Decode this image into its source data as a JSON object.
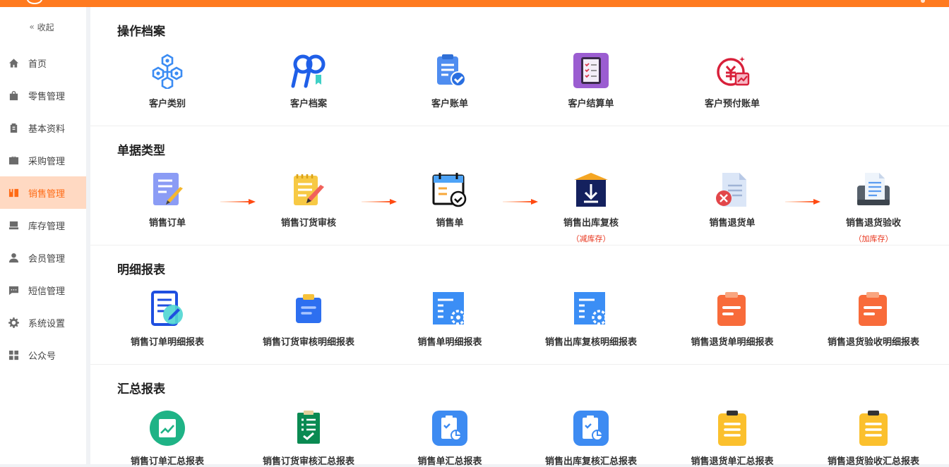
{
  "colors": {
    "accent": "#ff7a1f",
    "active_bg": "#ffd9c2",
    "note": "#e8331a"
  },
  "sidebar": {
    "collapse_label": "收起",
    "items": [
      {
        "label": "首页",
        "icon": "home-icon"
      },
      {
        "label": "零售管理",
        "icon": "shopping-bag-icon"
      },
      {
        "label": "基本资料",
        "icon": "clipboard-icon"
      },
      {
        "label": "采购管理",
        "icon": "briefcase-icon"
      },
      {
        "label": "销售管理",
        "icon": "book-icon",
        "active": true
      },
      {
        "label": "库存管理",
        "icon": "inbox-icon"
      },
      {
        "label": "会员管理",
        "icon": "user-icon"
      },
      {
        "label": "短信管理",
        "icon": "chat-icon"
      },
      {
        "label": "系统设置",
        "icon": "gear-icon"
      },
      {
        "label": "公众号",
        "icon": "grid-icon"
      }
    ]
  },
  "sections": {
    "archives": {
      "title": "操作档案",
      "items": [
        {
          "label": "客户类别",
          "icon": "hexagon-network-icon"
        },
        {
          "label": "客户档案",
          "icon": "people-icon"
        },
        {
          "label": "客户账单",
          "icon": "clipboard-check-icon"
        },
        {
          "label": "客户结算单",
          "icon": "checklist-tablet-icon"
        },
        {
          "label": "客户预付账单",
          "icon": "yuan-coin-icon"
        }
      ]
    },
    "doc_types": {
      "title": "单据类型",
      "items": [
        {
          "label": "销售订单",
          "icon": "edit-document-icon",
          "note": ""
        },
        {
          "label": "销售订货审核",
          "icon": "notepad-pencil-icon",
          "note": ""
        },
        {
          "label": "销售单",
          "icon": "calendar-check-icon",
          "note": ""
        },
        {
          "label": "销售出库复核",
          "icon": "download-box-icon",
          "note": "（减库存）"
        },
        {
          "label": "销售退货单",
          "icon": "document-cancel-icon",
          "note": ""
        },
        {
          "label": "销售退货验收",
          "icon": "document-scanner-icon",
          "note": "（加库存）"
        }
      ]
    },
    "detail_reports": {
      "title": "明细报表",
      "items": [
        {
          "label": "销售订单明细报表",
          "icon": "report-edit-icon"
        },
        {
          "label": "销售订货审核明细报表",
          "icon": "small-clipboard-icon"
        },
        {
          "label": "销售单明细报表",
          "icon": "document-gear-icon"
        },
        {
          "label": "销售出库复核明细报表",
          "icon": "document-gear-icon"
        },
        {
          "label": "销售退货单明细报表",
          "icon": "orange-clipboard-icon"
        },
        {
          "label": "销售退货验收明细报表",
          "icon": "orange-clipboard-icon"
        }
      ]
    },
    "summary_reports": {
      "title": "汇总报表",
      "items": [
        {
          "label": "销售订单汇总报表",
          "icon": "chart-circle-icon"
        },
        {
          "label": "销售订货审核汇总报表",
          "icon": "green-checklist-icon"
        },
        {
          "label": "销售单汇总报表",
          "icon": "clipboard-pie-icon"
        },
        {
          "label": "销售出库复核汇总报表",
          "icon": "clipboard-pie-icon"
        },
        {
          "label": "销售退货单汇总报表",
          "icon": "yellow-list-icon"
        },
        {
          "label": "销售退货验收汇总报表",
          "icon": "yellow-list-icon"
        }
      ]
    }
  }
}
